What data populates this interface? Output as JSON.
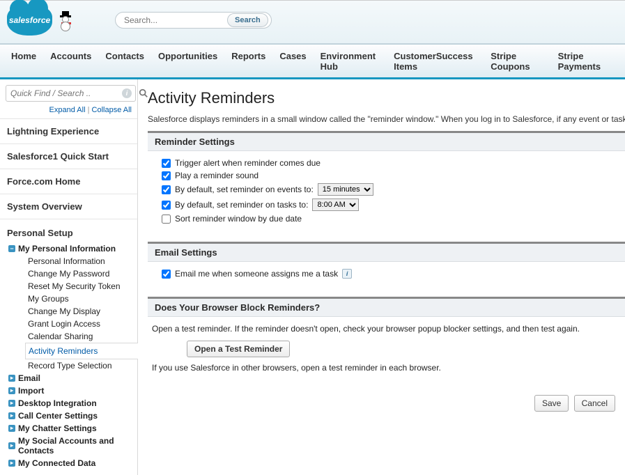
{
  "brand": {
    "logo_text": "salesforce"
  },
  "search": {
    "placeholder": "Search...",
    "button": "Search"
  },
  "tabs": [
    {
      "label": "Home"
    },
    {
      "label": "Accounts"
    },
    {
      "label": "Contacts"
    },
    {
      "label": "Opportunities"
    },
    {
      "label": "Reports"
    },
    {
      "label": "Cases"
    },
    {
      "label": "Environment Hub"
    },
    {
      "label": "CustomerSuccess Items"
    },
    {
      "label": "Stripe Coupons"
    },
    {
      "label": "Stripe Payments"
    }
  ],
  "sidebar": {
    "quick_find_placeholder": "Quick Find / Search ..",
    "expand_all": "Expand All",
    "collapse_all": "Collapse All",
    "sections": [
      "Lightning Experience",
      "Salesforce1 Quick Start",
      "Force.com Home",
      "System Overview"
    ],
    "personal_setup": "Personal Setup",
    "mpi": {
      "label": "My Personal Information",
      "items": [
        "Personal Information",
        "Change My Password",
        "Reset My Security Token",
        "My Groups",
        "Change My Display",
        "Grant Login Access",
        "Calendar Sharing",
        "Activity Reminders",
        "Record Type Selection"
      ]
    },
    "bottom": [
      "Email",
      "Import",
      "Desktop Integration",
      "Call Center Settings",
      "My Chatter Settings",
      "My Social Accounts and Contacts",
      "My Connected Data"
    ]
  },
  "page": {
    "title": "Activity Reminders",
    "intro": "Salesforce displays reminders in a small window called the \"reminder window.\" When you log in to Salesforce, if any event or task re"
  },
  "reminder": {
    "heading": "Reminder Settings",
    "trigger": "Trigger alert when reminder comes due",
    "sound": "Play a reminder sound",
    "events_label": "By default, set reminder on events to:",
    "events_value": "15 minutes",
    "tasks_label": "By default, set reminder on tasks to:",
    "tasks_value": "8:00 AM",
    "sort": "Sort reminder window by due date"
  },
  "email": {
    "heading": "Email Settings",
    "assign": "Email me when someone assigns me a task"
  },
  "block": {
    "heading": "Does Your Browser Block Reminders?",
    "p1": "Open a test reminder. If the reminder doesn't open, check your browser popup blocker settings, and then test again.",
    "button": "Open a Test Reminder",
    "p2": "If you use Salesforce in other browsers, open a test reminder in each browser."
  },
  "buttons": {
    "save": "Save",
    "cancel": "Cancel"
  }
}
